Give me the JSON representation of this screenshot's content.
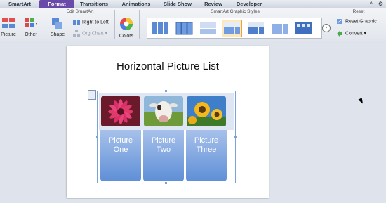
{
  "tabs": [
    {
      "label": "SmartArt",
      "active": false
    },
    {
      "label": "Format",
      "active": true
    },
    {
      "label": "Transitions",
      "active": false
    },
    {
      "label": "Animations",
      "active": false
    },
    {
      "label": "Slide Show",
      "active": false
    },
    {
      "label": "Review",
      "active": false
    },
    {
      "label": "Developer",
      "active": false
    }
  ],
  "ribbon": {
    "picture_label": "Picture",
    "other_label": "Other",
    "edit_smartart": {
      "title": "Edit SmartArt",
      "shape_label": "Shape",
      "right_to_left_label": "Right to Left",
      "org_chart_label": "Org Chart"
    },
    "colors_label": "Colors",
    "graphic_styles_title": "SmartArt Graphic Styles",
    "reset": {
      "title": "Reset",
      "reset_graphic_label": "Reset Graphic",
      "convert_label": "Convert"
    }
  },
  "slide": {
    "title": "Horizontal Picture List",
    "items": [
      {
        "label_line1": "Picture",
        "label_line2": "One",
        "picture": "pink-flower"
      },
      {
        "label_line1": "Picture",
        "label_line2": "Two",
        "picture": "cow"
      },
      {
        "label_line1": "Picture",
        "label_line2": "Three",
        "picture": "sunflowers"
      }
    ]
  },
  "colors": {
    "active_tab": "#6a4aa8",
    "smartart_fill": "#5f8fd7",
    "selection_accent": "#e8a33a"
  }
}
